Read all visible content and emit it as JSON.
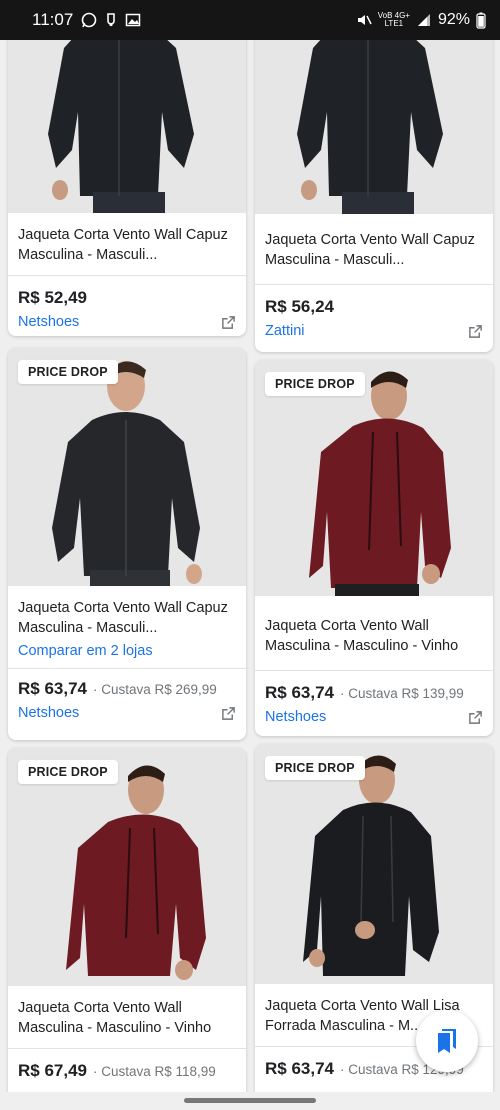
{
  "status_bar": {
    "time": "11:07",
    "network_top": "VoB 4G+",
    "network_bottom": "LTE1",
    "battery": "92%"
  },
  "products": [
    {
      "title": "Jaqueta Corta Vento Wall Capuz Masculina - Masculi...",
      "price": "R$ 52,49",
      "store": "Netshoes",
      "jacket_color": "#1f2226"
    },
    {
      "title": "Jaqueta Corta Vento Wall Capuz Masculina - Masculi...",
      "price": "R$ 56,24",
      "store": "Zattini",
      "jacket_color": "#1f2226"
    },
    {
      "badge": "PRICE DROP",
      "title": "Jaqueta Corta Vento Wall Capuz Masculina - Masculi...",
      "compare": "Comparar em 2 lojas",
      "price": "R$ 63,74",
      "was": "· Custava R$ 269,99",
      "store": "Netshoes",
      "jacket_color": "#25272b"
    },
    {
      "badge": "PRICE DROP",
      "title": "Jaqueta Corta Vento Wall Masculina - Masculino - Vinho",
      "price": "R$ 63,74",
      "was": "· Custava R$ 139,99",
      "store": "Netshoes",
      "jacket_color": "#6e1a22"
    },
    {
      "badge": "PRICE DROP",
      "title": "Jaqueta Corta Vento Wall Masculina - Masculino - Vinho",
      "price": "R$ 67,49",
      "was": "· Custava R$ 118,99",
      "jacket_color": "#6e1a22"
    },
    {
      "badge": "PRICE DROP",
      "title": "Jaqueta Corta Vento Wall Lisa Forrada Masculina - M...",
      "price": "R$ 63,74",
      "was": "· Custava R$ 129,99",
      "jacket_color": "#1b1c1f"
    }
  ],
  "colors": {
    "link": "#1a73e8",
    "text": "#202124",
    "muted": "#70757a",
    "image_bg": "#e6e6e6"
  },
  "icons": {
    "external": "open-in-new-icon",
    "fab": "bookmark-collection-icon"
  }
}
